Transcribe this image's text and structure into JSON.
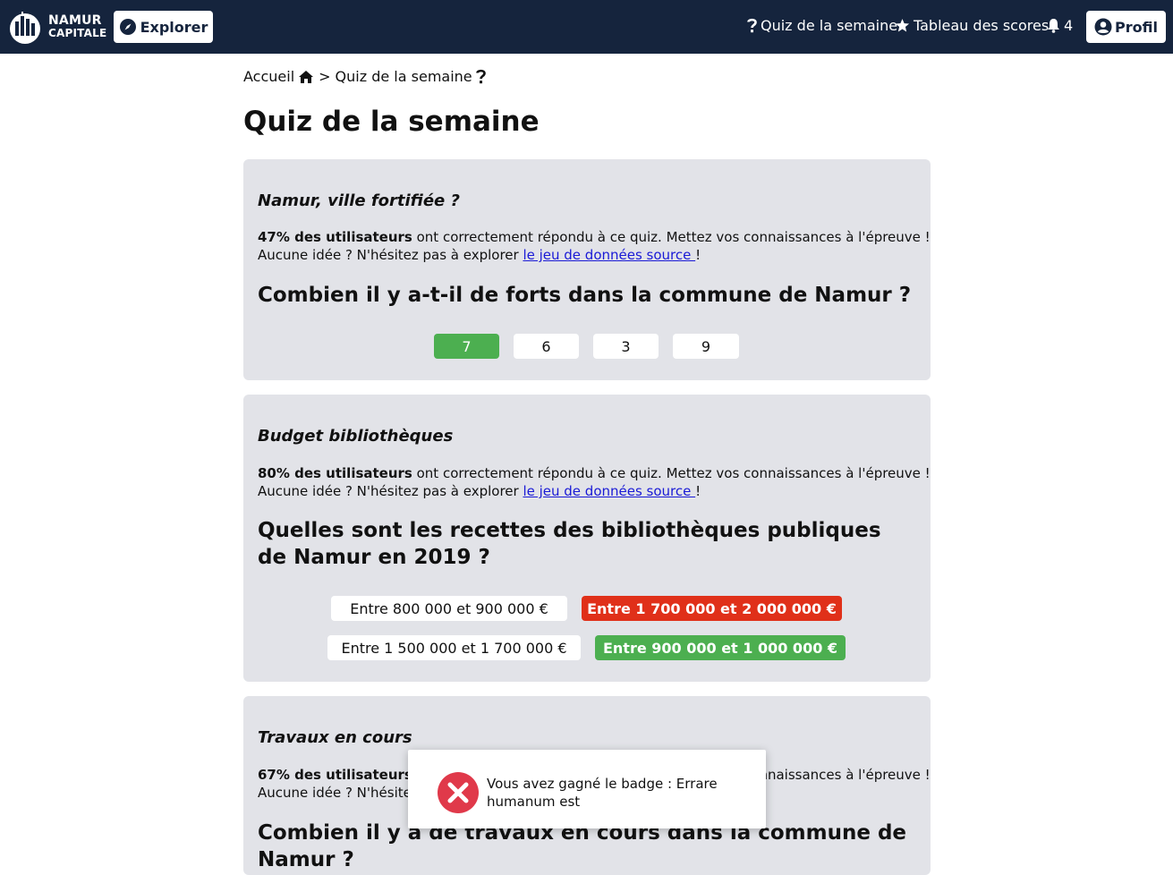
{
  "nav": {
    "logo_line1": "NAMUR",
    "logo_line2": "CAPITALE",
    "explore_label": "Explorer",
    "quiz_link": "Quiz de la semaine",
    "scores_link": "Tableau des scores",
    "notifications_count": "4",
    "profile_label": "Profil"
  },
  "breadcrumb": {
    "home": "Accueil",
    "separator": ">",
    "current": "Quiz de la semaine"
  },
  "page_title": "Quiz de la semaine",
  "quizzes": [
    {
      "name": "Namur, ville fortifiée ?",
      "stat_bold": "47% des utilisateurs",
      "stat_rest": " ont correctement répondu à ce quiz. Mettez vos connaissances à l'épreuve !",
      "hint_prefix": "Aucune idée ? N'hésitez pas à explorer ",
      "hint_link": "le jeu de données source ",
      "hint_suffix": "!",
      "question": "Combien il y a-t-il de forts dans la commune de Namur ?",
      "answers": [
        {
          "label": "7",
          "state": "correct"
        },
        {
          "label": "6",
          "state": "neutral"
        },
        {
          "label": "3",
          "state": "neutral"
        },
        {
          "label": "9",
          "state": "neutral"
        }
      ]
    },
    {
      "name": "Budget bibliothèques",
      "stat_bold": "80% des utilisateurs",
      "stat_rest": " ont correctement répondu à ce quiz. Mettez vos connaissances à l'épreuve !",
      "hint_prefix": "Aucune idée ? N'hésitez pas à explorer ",
      "hint_link": "le jeu de données source ",
      "hint_suffix": "!",
      "question": "Quelles sont les recettes des bibliothèques publiques de Namur en 2019 ?",
      "answers": [
        {
          "label": "Entre 800 000 et 900 000 €",
          "state": "neutral"
        },
        {
          "label": "Entre 1 700 000 et 2 000 000 €",
          "state": "wrong"
        },
        {
          "label": "Entre 1 500 000 et 1 700 000 €",
          "state": "neutral"
        },
        {
          "label": "Entre 900 000 et 1 000 000 €",
          "state": "correct"
        }
      ]
    },
    {
      "name": "Travaux en cours",
      "stat_bold": "67% des utilisateurs",
      "stat_rest": " ont correctement répondu à ce quiz. Mettez vos connaissances à l'épreuve !",
      "hint_prefix": "Aucune idée ? N'hésitez pas à explorer ",
      "question": "Combien il y a de travaux en cours dans la commune de Namur ?"
    }
  ],
  "toast": {
    "message": "Vous avez gagné le badge : Errare humanum est",
    "icon": "error-x-icon"
  },
  "colors": {
    "navbar": "#15243d",
    "card": "#e2e3e8",
    "correct": "#4caf50",
    "wrong": "#e03019",
    "link": "#1a1ad6"
  }
}
